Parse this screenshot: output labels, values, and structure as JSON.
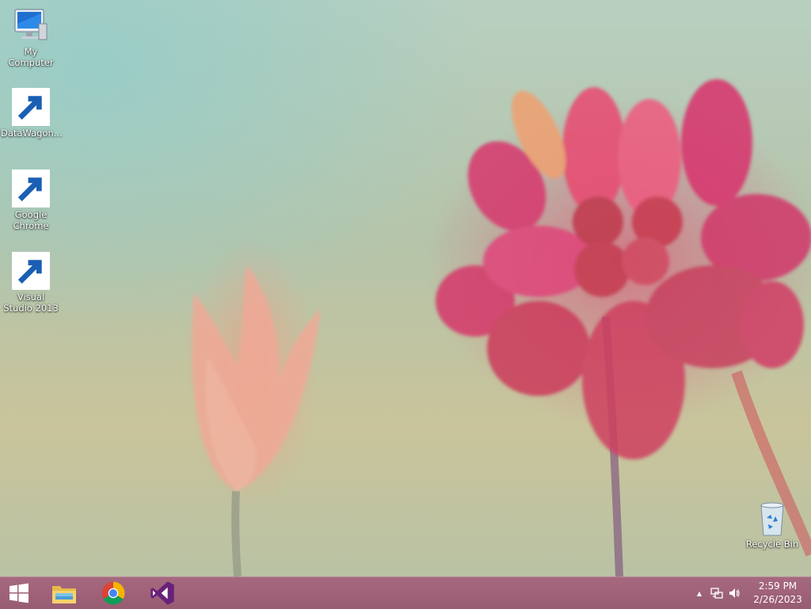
{
  "desktop": {
    "icons": [
      {
        "label": "My Computer",
        "icon": "my-computer-icon"
      },
      {
        "label": "DataWagon...",
        "icon": "datawagon-icon"
      },
      {
        "label": "Google Chrome",
        "icon": "chrome-icon"
      },
      {
        "label": "Visual Studio 2013",
        "icon": "visual-studio-icon"
      }
    ],
    "recycle_bin": {
      "label": "Recycle Bin",
      "icon": "recycle-bin-icon"
    }
  },
  "taskbar": {
    "pinned": [
      "start-icon",
      "file-explorer-icon",
      "chrome-icon",
      "visual-studio-icon"
    ],
    "tray": {
      "expand_glyph": "▲",
      "time": "2:59 PM",
      "date": "2/26/2023"
    }
  },
  "colors": {
    "taskbar": "#9b5c74",
    "vs_purple": "#68217a"
  }
}
